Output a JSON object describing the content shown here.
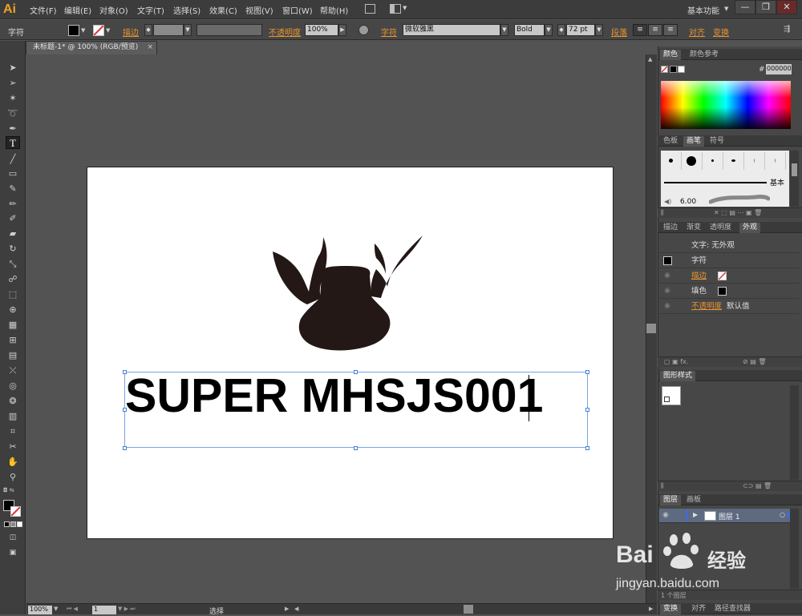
{
  "app": {
    "logo": "Ai",
    "menu": [
      "文件(F)",
      "编辑(E)",
      "对象(O)",
      "文字(T)",
      "选择(S)",
      "效果(C)",
      "视图(V)",
      "窗口(W)",
      "帮助(H)"
    ],
    "workspace": "基本功能",
    "window_buttons": [
      "—",
      "❐",
      "✕"
    ]
  },
  "control": {
    "selection_type": "字符",
    "stroke_label": "描边",
    "opacity_label": "不透明度",
    "opacity_value": "100%",
    "char_label": "字符",
    "font_family": "微软雅黑",
    "font_style": "Bold",
    "font_size": "72 pt",
    "paragraph_label": "段落",
    "align_label": "对齐",
    "transform_label": "变换"
  },
  "document": {
    "tab_title": "未标题-1* @ 100% (RGB/预览)",
    "tab_close": "×",
    "art_text": "SUPER MHSJS001"
  },
  "status": {
    "zoom": "100%",
    "page": "1",
    "mode": "选择"
  },
  "color_panel": {
    "tabs": [
      "颜色",
      "颜色参考"
    ],
    "hex_label": "#",
    "hex_value": "000000"
  },
  "brush_panel": {
    "tabs": [
      "色板",
      "画笔",
      "符号"
    ],
    "basic_label": "基本",
    "size_value": "6.00"
  },
  "appearance_panel": {
    "tabs": [
      "描边",
      "渐变",
      "透明度",
      "外观"
    ],
    "header": "文字: 无外观",
    "rows": [
      {
        "label": "字符"
      },
      {
        "label": "描边",
        "orange": true
      },
      {
        "label": "填色"
      },
      {
        "label": "不透明度",
        "orange": true,
        "value": "默认值"
      }
    ]
  },
  "graphic_styles_panel": {
    "tabs": [
      "图形样式"
    ]
  },
  "layers_panel": {
    "tabs": [
      "图层",
      "画板"
    ],
    "layer_name": "图层 1",
    "footer_count": "1 个图层"
  },
  "bottom_panel": {
    "tabs": [
      "变换",
      "对齐",
      "路径查找器"
    ]
  },
  "watermark": {
    "brand": "Bai",
    "brand2": "经验",
    "url": "jingyan.baidu.com"
  },
  "colors": {
    "accent_orange": "#e8952f",
    "logo_orange": "#f0a12c",
    "selection_blue": "#4a7fd8",
    "artwork_brown": "#231815"
  }
}
